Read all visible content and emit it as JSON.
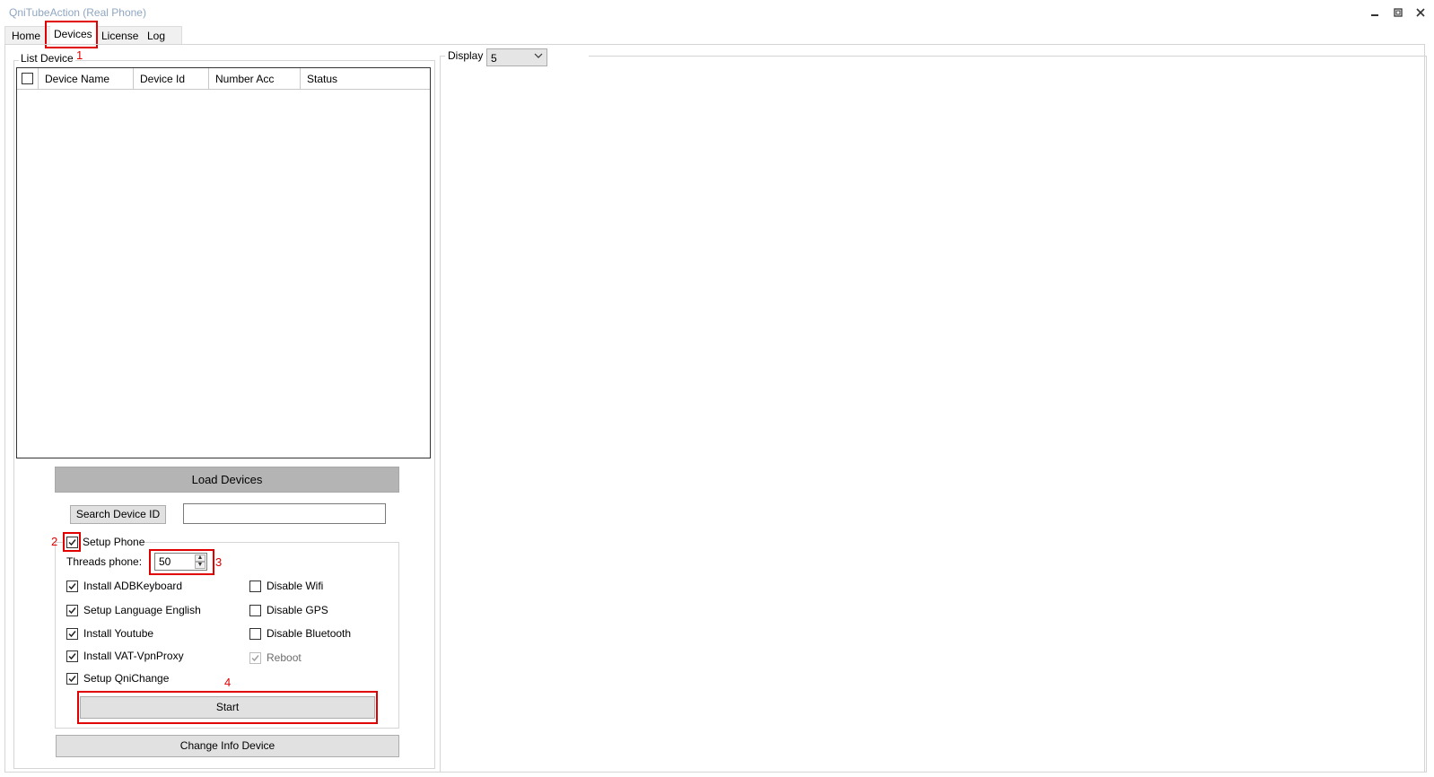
{
  "window": {
    "title": "QniTubeAction (Real Phone)"
  },
  "tabs": [
    {
      "label": "Home"
    },
    {
      "label": "Devices"
    },
    {
      "label": "License"
    },
    {
      "label": "Log"
    }
  ],
  "list_device": {
    "caption": "List Device",
    "columns": [
      "Device Name",
      "Device Id",
      "Number Acc",
      "Status"
    ],
    "rows": []
  },
  "buttons": {
    "load_devices": "Load Devices",
    "search_device_id": "Search Device ID",
    "start": "Start",
    "change_info_device": "Change Info Device"
  },
  "search": {
    "value": ""
  },
  "setup_phone": {
    "label": "Setup Phone",
    "checked": true,
    "threads_label": "Threads phone:",
    "threads_value": "50",
    "options_left": [
      {
        "label": "Install ADBKeyboard",
        "checked": true
      },
      {
        "label": "Setup Language English",
        "checked": true
      },
      {
        "label": "Install Youtube",
        "checked": true
      },
      {
        "label": "Install VAT-VpnProxy",
        "checked": true
      },
      {
        "label": "Setup QniChange",
        "checked": true
      }
    ],
    "options_right": [
      {
        "label": "Disable Wifi",
        "checked": false
      },
      {
        "label": "Disable GPS",
        "checked": false
      },
      {
        "label": "Disable Bluetooth",
        "checked": false
      },
      {
        "label": "Reboot",
        "checked": true,
        "disabled": true
      }
    ]
  },
  "display": {
    "label": "Display",
    "value": "5"
  },
  "annotations": [
    "1",
    "2",
    "3",
    "4"
  ],
  "colors": {
    "annotation": "#e00000",
    "title_text": "#8fa6c2",
    "load_button_bg": "#b4b4b4"
  }
}
